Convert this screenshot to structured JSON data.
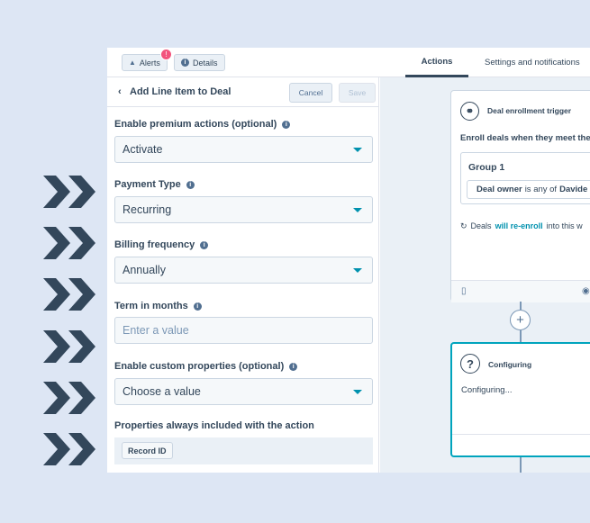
{
  "topbar": {
    "alerts_label": "Alerts",
    "alerts_badge": "!",
    "details_label": "Details",
    "tabs": [
      "Actions",
      "Settings and notifications"
    ]
  },
  "panel": {
    "back_glyph": "‹",
    "title": "Add Line Item to Deal",
    "cancel_label": "Cancel",
    "save_label": "Save",
    "fields": [
      {
        "label": "Enable premium actions (optional)",
        "value": "Activate"
      },
      {
        "label": "Payment Type",
        "value": "Recurring"
      },
      {
        "label": "Billing frequency",
        "value": "Annually"
      },
      {
        "label": "Term in months",
        "placeholder": "Enter a value"
      },
      {
        "label": "Enable custom properties (optional)",
        "value": "Choose a value"
      }
    ],
    "properties_label": "Properties always included with the action",
    "property_tag": "Record ID"
  },
  "canvas": {
    "trigger_title": "Deal enrollment trigger",
    "enroll_text": "Enroll deals when they meet the",
    "group_title": "Group 1",
    "filter_prop": "Deal owner",
    "filter_op": "is any of",
    "filter_value": "Davide",
    "reenroll_pre": "Deals",
    "reenroll_link": "will re-enroll",
    "reenroll_post": "into this w",
    "configuring_title": "Configuring",
    "configuring_body": "Configuring..."
  },
  "colors": {
    "background": "#dde6f4",
    "chevron": "#33475b",
    "accent": "#0091ae",
    "selected_border": "#00a4bd",
    "badge": "#f2547d"
  }
}
